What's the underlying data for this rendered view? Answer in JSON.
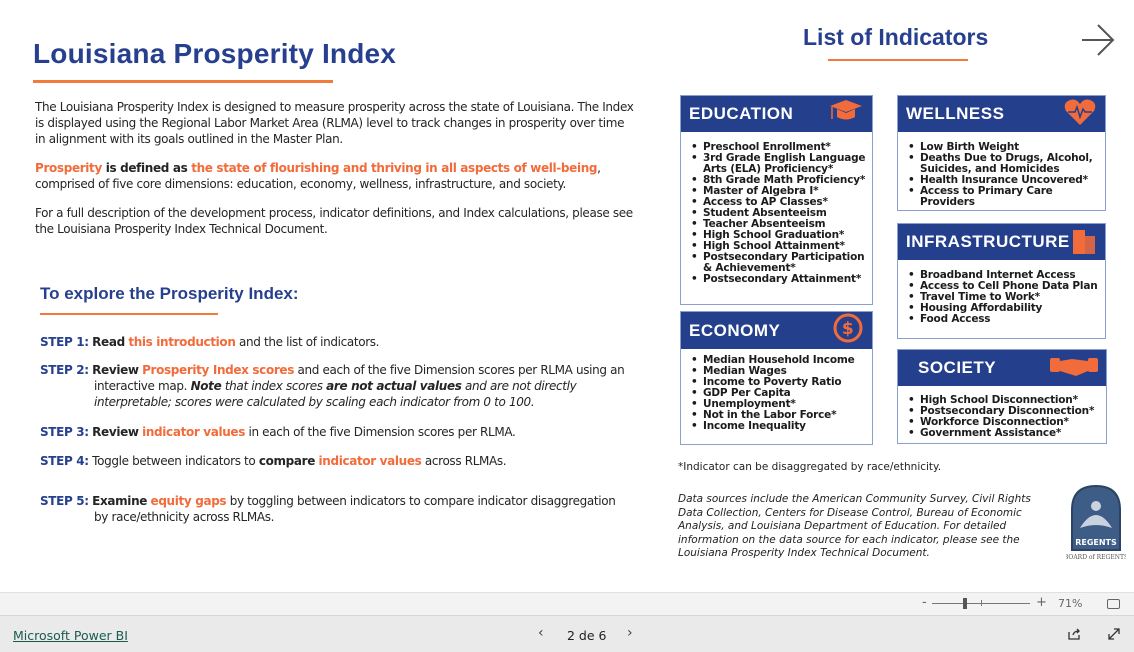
{
  "title": "Louisiana Prosperity Index",
  "intro": {
    "p1": "The Louisiana Prosperity Index is designed to measure prosperity across the state of Louisiana. The Index is displayed using the Regional Labor Market Area (RLMA) level to track changes in prosperity over time in alignment with its goals outlined in the Master Plan.",
    "p2": {
      "a": "Prosperity",
      "b": " is defined as ",
      "c": "the state of flourishing and thriving in all aspects of well-being",
      "d": ", comprised of five core dimensions: education, economy, wellness, infrastructure, and society."
    },
    "p3": "For a full description of the development process, indicator definitions, and Index calculations, please see the Louisiana Prosperity Index Technical Document."
  },
  "explore": {
    "heading": "To explore the Prosperity Index:",
    "step1": {
      "label": "STEP 1:",
      "a": "Read",
      "b": "this introduction",
      "c": " and the list of indicators."
    },
    "step2": {
      "label": "STEP 2:",
      "a": "Review",
      "b": "Prosperity Index scores",
      "c": " and each of the five Dimension scores per RLMA using an",
      "d": "interactive map. ",
      "e": "Note",
      "f": " that index scores ",
      "g": "are not actual values",
      "h": " and are not directly",
      "i": "interpretable; scores were calculated by scaling each indicator from 0 to 100."
    },
    "step3": {
      "label": "STEP 3:",
      "a": "Review",
      "b": "indicator values",
      "c": " in each of the five Dimension scores per RLMA."
    },
    "step4": {
      "label": "STEP 4:",
      "a": " Toggle between indicators to ",
      "b": "compare",
      "c": "indicator values",
      "d": " across RLMAs."
    },
    "step5": {
      "label": "STEP 5:",
      "a": "Examine",
      "b": "equity gaps",
      "c": " by toggling between indicators to compare indicator disaggregation",
      "d": "by race/ethnicity across RLMAs."
    }
  },
  "indicators": {
    "title": "List of Indicators",
    "next_icon": "arrow-right-icon",
    "education": {
      "title": "EDUCATION",
      "icon": "graduation-cap-icon",
      "items": [
        "Preschool Enrollment*",
        "3rd Grade English Language Arts (ELA) Proficiency*",
        "8th Grade Math Proficiency*",
        "Master of Algebra I*",
        "Access to AP Classes*",
        "Student Absenteeism",
        "Teacher Absenteeism",
        "High School Graduation*",
        "High School Attainment*",
        "Postsecondary Participation & Achievement*",
        "Postsecondary Attainment*"
      ]
    },
    "wellness": {
      "title": "WELLNESS",
      "icon": "heart-pulse-icon",
      "items": [
        "Low Birth Weight",
        "Deaths Due to Drugs, Alcohol, Suicides, and Homicides",
        "Health Insurance Uncovered*",
        "Access to Primary Care Providers"
      ]
    },
    "infrastructure": {
      "title": "INFRASTRUCTURE",
      "icon": "buildings-icon",
      "items": [
        "Broadband Internet Access",
        "Access to Cell Phone Data Plan",
        "Travel Time to Work*",
        "Housing Affordability",
        "Food Access"
      ]
    },
    "economy": {
      "title": "ECONOMY",
      "icon": "dollar-icon",
      "items": [
        "Median Household Income",
        "Median Wages",
        "Income to Poverty Ratio",
        "GDP Per Capita",
        "Unemployment*",
        "Not in the Labor Force*",
        "Income Inequality"
      ]
    },
    "society": {
      "title": "SOCIETY",
      "icon": "handshake-icon",
      "items": [
        "High School Disconnection*",
        "Postsecondary Disconnection*",
        "Workforce Disconnection*",
        "Government Assistance*"
      ]
    },
    "footnote": "*Indicator can be disaggregated by race/ethnicity.",
    "sources": "Data sources include the American Community Survey, Civil Rights Data Collection, Centers for Disease Control, Bureau of Economic Analysis, and Louisiana Department of Education. For detailed information on the data source for each indicator, please see the Louisiana Prosperity Index Technical Document.",
    "logo": {
      "text": "REGENTS",
      "sub": "BOARD of REGENTS"
    }
  },
  "zoom": {
    "minus": "-",
    "plus": "+",
    "level": "71%",
    "value_percent": 71
  },
  "footer": {
    "brand": "Microsoft Power BI",
    "page": "2 de 6"
  },
  "colors": {
    "navy": "#263f8e",
    "orange": "#f26b3a",
    "box_header": "#243f8c"
  }
}
